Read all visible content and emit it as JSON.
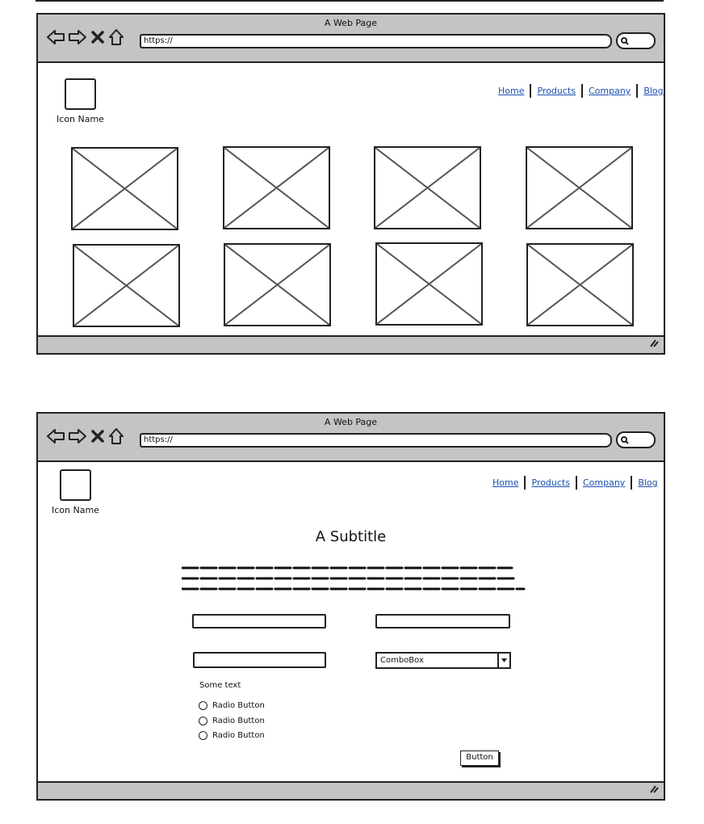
{
  "wireframe_top": {
    "window_title": "A Web Page",
    "url": "https://",
    "icon": {
      "label": "Icon Name"
    },
    "nav": {
      "home": "Home",
      "products": "Products",
      "company": "Company",
      "blog": "Blog"
    },
    "image_placeholder_count": 8
  },
  "wireframe_bottom": {
    "window_title": "A Web Page",
    "url": "https://",
    "icon": {
      "label": "Icon Name"
    },
    "nav": {
      "home": "Home",
      "products": "Products",
      "company": "Company",
      "blog": "Blog"
    },
    "subtitle": "A Subtitle",
    "combobox": {
      "value": "ComboBox"
    },
    "some_text": "Some text",
    "radios": [
      "Radio Button",
      "Radio Button",
      "Radio Button"
    ],
    "button_label": "Button"
  },
  "colors": {
    "chrome": "#c4c4c4",
    "stroke": "#222222",
    "link": "#1a4fb0",
    "background": "#ffffff"
  }
}
